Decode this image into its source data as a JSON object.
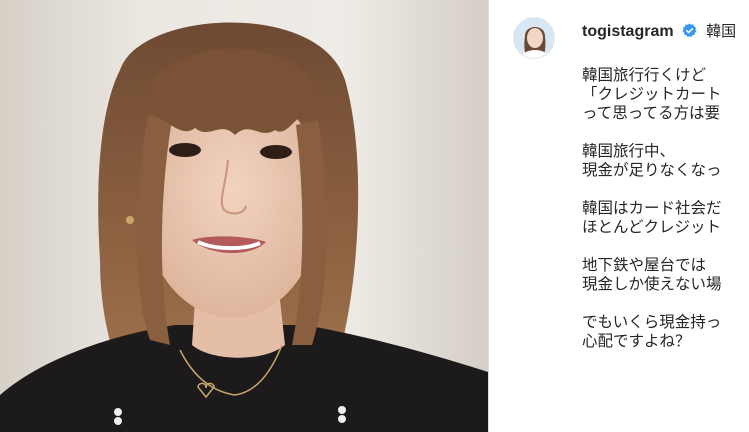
{
  "post": {
    "username": "togistagram",
    "header_text": "韓国",
    "icons": {
      "avatar": "profile-avatar",
      "verified": "verified-badge-icon"
    },
    "colors": {
      "verified_blue": "#3897f0",
      "text": "#262626",
      "divider": "#dbdbdb"
    },
    "caption_paragraphs": [
      [
        "韓国旅行行くけど",
        "「クレジットカート",
        "って思ってる方は要"
      ],
      [
        "韓国旅行中、",
        "現金が足りなくなっ"
      ],
      [
        "韓国はカード社会だ",
        "ほとんどクレジット"
      ],
      [
        "地下鉄や屋台では",
        "現金しか使えない場"
      ],
      [
        "でもいくら現金持っ",
        "心配ですよね？"
      ]
    ]
  }
}
